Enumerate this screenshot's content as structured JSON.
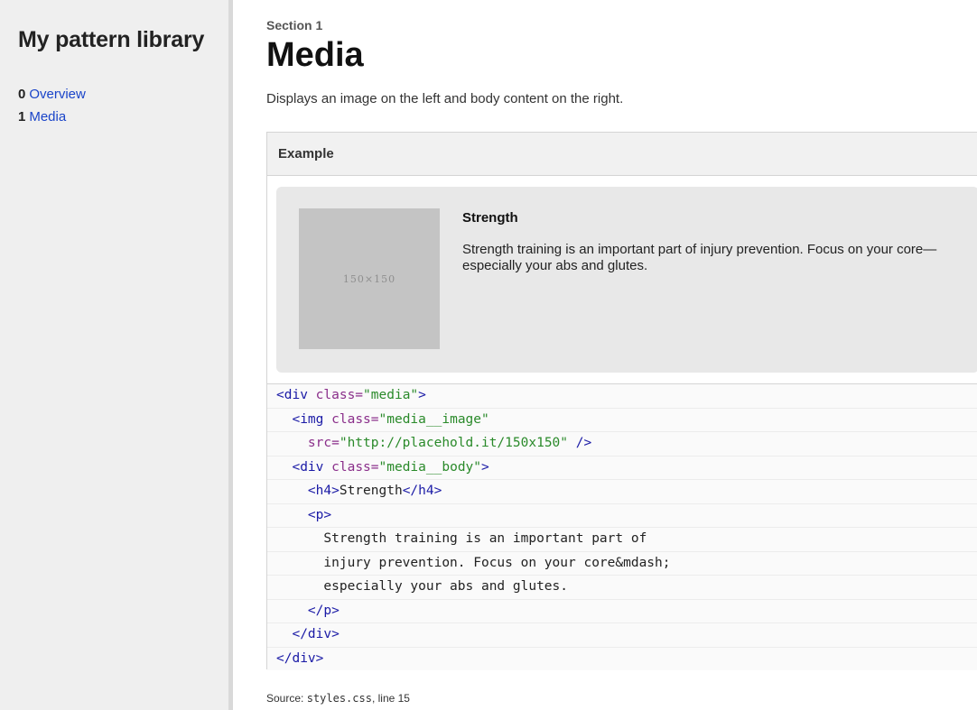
{
  "sidebar": {
    "title": "My pattern library",
    "items": [
      {
        "num": "0",
        "label": "Overview"
      },
      {
        "num": "1",
        "label": "Media"
      }
    ]
  },
  "section": {
    "label": "Section 1",
    "title": "Media",
    "description": "Displays an image on the left and body content on the right."
  },
  "example": {
    "header": "Example",
    "image_placeholder": "150×150",
    "heading": "Strength",
    "body": "Strength training is an important part of injury prevention. Focus on your core— especially your abs and glutes."
  },
  "code_lines": [
    [
      [
        "tag",
        "<div "
      ],
      [
        "attr",
        "class="
      ],
      [
        "val",
        "\"media\""
      ],
      [
        "tag",
        ">"
      ]
    ],
    [
      [
        "plain",
        "  "
      ],
      [
        "tag",
        "<img "
      ],
      [
        "attr",
        "class="
      ],
      [
        "val",
        "\"media__image\""
      ]
    ],
    [
      [
        "plain",
        "    "
      ],
      [
        "attr",
        "src="
      ],
      [
        "val",
        "\"http://placehold.it/150x150\""
      ],
      [
        "tag",
        " />"
      ]
    ],
    [
      [
        "plain",
        "  "
      ],
      [
        "tag",
        "<div "
      ],
      [
        "attr",
        "class="
      ],
      [
        "val",
        "\"media__body\""
      ],
      [
        "tag",
        ">"
      ]
    ],
    [
      [
        "plain",
        "    "
      ],
      [
        "tag",
        "<h4>"
      ],
      [
        "plain",
        "Strength"
      ],
      [
        "tag",
        "</h4>"
      ]
    ],
    [
      [
        "plain",
        "    "
      ],
      [
        "tag",
        "<p>"
      ]
    ],
    [
      [
        "plain",
        "      Strength training is an important part of"
      ]
    ],
    [
      [
        "plain",
        "      injury prevention. Focus on your core&mdash;"
      ]
    ],
    [
      [
        "plain",
        "      especially your abs and glutes."
      ]
    ],
    [
      [
        "plain",
        "    "
      ],
      [
        "tag",
        "</p>"
      ]
    ],
    [
      [
        "plain",
        "  "
      ],
      [
        "tag",
        "</div>"
      ]
    ],
    [
      [
        "tag",
        "</div>"
      ]
    ]
  ],
  "source": {
    "prefix": "Source: ",
    "file": "styles.css",
    "suffix": ", line 15"
  },
  "colors": {
    "link": "#1a44c9",
    "tag": "#1a1aa6",
    "attr": "#8a2e8a",
    "value": "#2a8a2a"
  }
}
